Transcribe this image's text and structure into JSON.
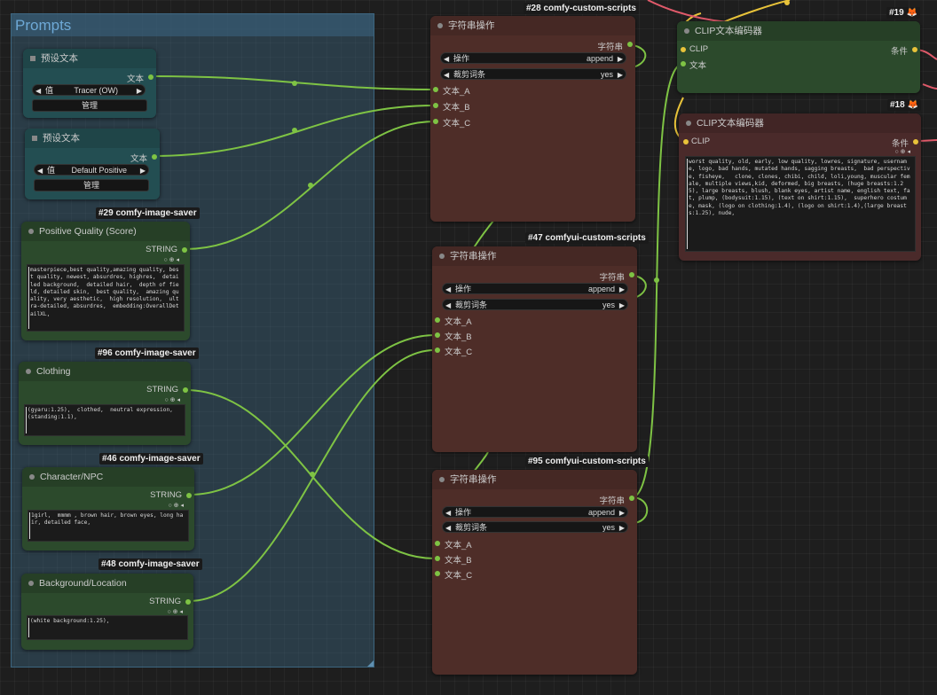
{
  "group": {
    "title": "Prompts"
  },
  "preset1": {
    "title": "预设文本",
    "out": "文本",
    "combo_label": "值",
    "combo_value": "Tracer (OW)",
    "button": "管理"
  },
  "preset2": {
    "title": "预设文本",
    "out": "文本",
    "combo_label": "值",
    "combo_value": "Default Positive",
    "button": "管理"
  },
  "pq": {
    "badge": "#29 comfy-image-saver",
    "title": "Positive Quality (Score)",
    "out": "STRING",
    "text": "masterpiece,best quality,amazing quality, best quality, newest, absurdres, highres,  detailed background,  detailed hair,  depth of field, detailed skin,  best quality,  amazing quality, very aesthetic,  high resolution,  ultra-detailed, absurdres,  embedding:OverallDetailXL,"
  },
  "clothing": {
    "badge": "#96 comfy-image-saver",
    "title": "Clothing",
    "out": "STRING",
    "text": "(gyaru:1.25),  clothed,  neutral expression, (standing:1.1),"
  },
  "charnpc": {
    "badge": "#46 comfy-image-saver",
    "title": "Character/NPC",
    "out": "STRING",
    "text": "1girl,  mmmm , brown hair, brown eyes, long hair, detailed face,"
  },
  "bg": {
    "badge": "#48 comfy-image-saver",
    "title": "Background/Location",
    "out": "STRING",
    "text": "(white background:1.25),"
  },
  "s28": {
    "badge": "#28 comfy-custom-scripts",
    "title": "字符串操作",
    "out": "字符串",
    "op_label": "操作",
    "op_value": "append",
    "strip_label": "裁剪词条",
    "strip_value": "yes",
    "in_a": "文本_A",
    "in_b": "文本_B",
    "in_c": "文本_C"
  },
  "s47": {
    "badge": "#47 comfyui-custom-scripts",
    "title": "字符串操作",
    "out": "字符串",
    "op_label": "操作",
    "op_value": "append",
    "strip_label": "裁剪词条",
    "strip_value": "yes",
    "in_a": "文本_A",
    "in_b": "文本_B",
    "in_c": "文本_C"
  },
  "s95": {
    "badge": "#95 comfyui-custom-scripts",
    "title": "字符串操作",
    "out": "字符串",
    "op_label": "操作",
    "op_value": "append",
    "strip_label": "裁剪词条",
    "strip_value": "yes",
    "in_a": "文本_A",
    "in_b": "文本_B",
    "in_c": "文本_C"
  },
  "clip19": {
    "badge": "#19",
    "title": "CLIP文本编码器",
    "in_clip": "CLIP",
    "in_text": "文本",
    "out": "条件"
  },
  "clip18": {
    "badge": "#18",
    "title": "CLIP文本编码器",
    "in_clip": "CLIP",
    "out": "条件",
    "text": "worst quality, old, early, low quality, lowres, signature, username, logo, bad hands, mutated hands, sagging breasts,  bad perspective, fisheye,   clone, clones, chibi, child, loli,young, muscular female, multiple views,kid, deformed, big breasts, (huge breasts:1.25), large breasts, blush, blank eyes, artist name, english text, fat, plump, (bodysuit:1.15), (text on shirt:1.15),  superhero costume, mask, (logo on clothing:1.4), (logo on shirt:1.4),(large breasts:1.25), nude,"
  },
  "colors": {
    "wire_string": "#7ec344",
    "wire_clip": "#e8c33a",
    "wire_red": "#e05a6a"
  }
}
